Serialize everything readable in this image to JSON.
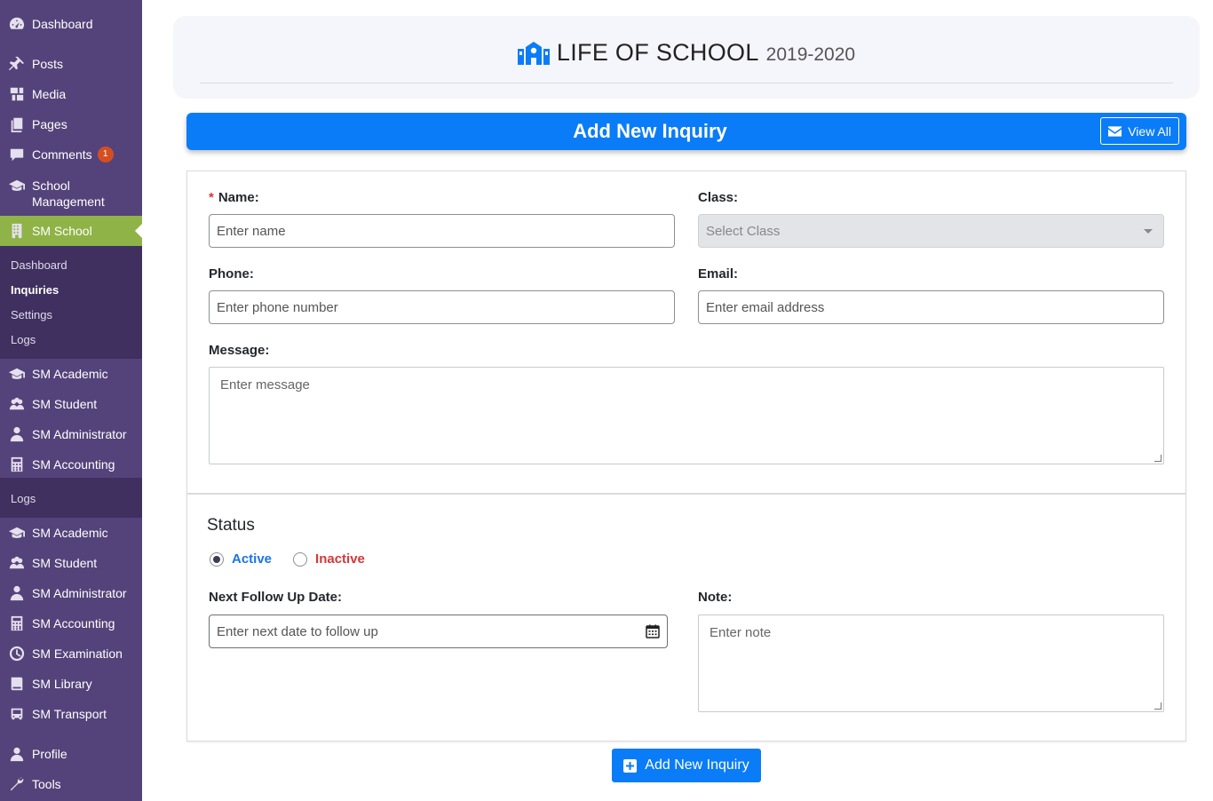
{
  "sidebar": {
    "top_items": [
      {
        "label": "Dashboard",
        "icon": "dashboard-icon"
      },
      {
        "label": "Posts",
        "icon": "pin-icon"
      },
      {
        "label": "Media",
        "icon": "media-icon"
      },
      {
        "label": "Pages",
        "icon": "pages-icon"
      },
      {
        "label": "Comments",
        "icon": "comment-icon",
        "badge": "1"
      },
      {
        "label": "School Management",
        "icon": "graduation-cap-icon"
      },
      {
        "label": "SM School",
        "icon": "building-icon"
      }
    ],
    "submenu": [
      "Dashboard",
      "Inquiries",
      "Settings",
      "Logs"
    ],
    "mid_items": [
      "SM Academic",
      "SM Student",
      "SM Administrator",
      "SM Accounting"
    ],
    "overlap_logs": "Logs",
    "bottom_items": [
      "SM Academic",
      "SM Student",
      "SM Administrator",
      "SM Accounting",
      "SM Examination",
      "SM Library",
      "SM Transport"
    ],
    "footer_items": [
      "Profile",
      "Tools"
    ]
  },
  "header": {
    "school_name": "LIFE OF SCHOOL",
    "session": "2019-2020"
  },
  "title_bar": {
    "title": "Add New Inquiry",
    "view_all": "View All"
  },
  "form": {
    "name_label": "Name:",
    "name_placeholder": "Enter name",
    "class_label": "Class:",
    "class_placeholder": "Select Class",
    "phone_label": "Phone:",
    "phone_placeholder": "Enter phone number",
    "email_label": "Email:",
    "email_placeholder": "Enter email address",
    "message_label": "Message:",
    "message_placeholder": "Enter message"
  },
  "status": {
    "title": "Status",
    "active_label": "Active",
    "inactive_label": "Inactive",
    "selected": "Active",
    "followup_label": "Next Follow Up Date:",
    "followup_placeholder": "Enter next date to follow up",
    "note_label": "Note:",
    "note_placeholder": "Enter note"
  },
  "submit_label": "Add New Inquiry",
  "colors": {
    "sidebar_bg": "#54437a",
    "submenu_bg": "#3f3060",
    "active_menu": "#8fb347",
    "primary_blue": "#0a7cf7",
    "inactive_red": "#d63638"
  }
}
